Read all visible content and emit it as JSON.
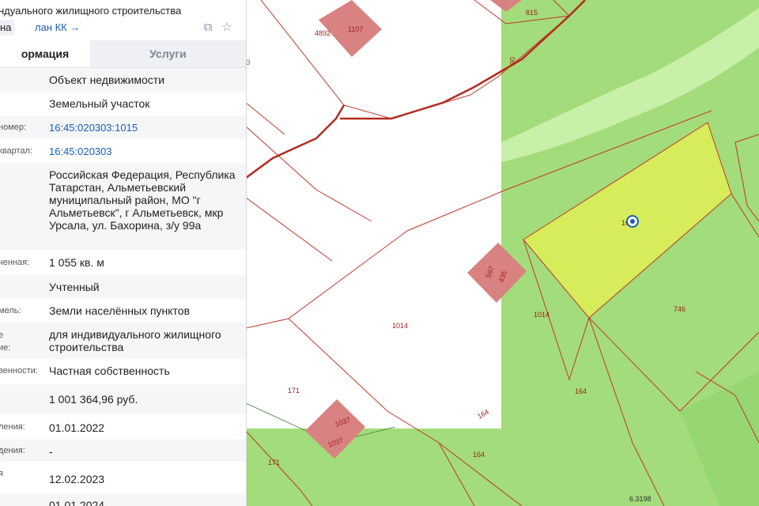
{
  "panel": {
    "header_title": "ндуального жилищного строительства",
    "chip_label": "на",
    "plan_link": "лан КК",
    "tabs": [
      {
        "label": "ормация"
      },
      {
        "label": "Услуги"
      }
    ],
    "rows": [
      {
        "label": "",
        "value": "Объект недвижимости"
      },
      {
        "label": "",
        "value": "Земельный участок"
      },
      {
        "label": "номер:",
        "value": "16:45:020303:1015"
      },
      {
        "label": "квартал:",
        "value": "16:45:020303"
      },
      {
        "label": "",
        "value": "Российская Федерация, Республика Татарстан, Альметьевский муниципальный район, МО \"г Альметьевск\", г Альметьевск, мкр Урсала, ул. Бахорина, з/у 99а"
      },
      {
        "label": "ченная:",
        "value": "1 055 кв. м"
      },
      {
        "label": "",
        "value": "Учтенный"
      },
      {
        "label": "мель:",
        "value": "Земли населённых пунктов"
      },
      {
        "label": "е\nие:",
        "value": "для индивидуального жилищного строительства"
      },
      {
        "label": "венности:",
        "value": "Частная собственность"
      },
      {
        "label": "",
        "value": "1 001 364,96 руб."
      },
      {
        "label": "ления:",
        "value": "01.01.2022"
      },
      {
        "label": "дения:",
        "value": "-"
      },
      {
        "label": "я",
        "value": "12.02.2023"
      },
      {
        "label": "",
        "value": "01.01.2024"
      }
    ]
  },
  "map": {
    "labels": {
      "l1107": "1107",
      "l4892": "4892",
      "l815": "815",
      "l06": "06",
      "l0": "0",
      "l1014a": "1014",
      "l1014b": "1014",
      "l587": "587",
      "l435": "435",
      "l746": "746",
      "l164a": "164",
      "l164b": "164",
      "l164c": "164",
      "l171a": "171",
      "l171b": "171",
      "l1037a": "1037",
      "l1037b": "1037",
      "l10": "10",
      "l6319": "6.3198"
    },
    "colors": {
      "green": "#a3dc7a",
      "light_green": "#c9f0a8",
      "selected": "#d6ec5a",
      "boundary": "#c0392b",
      "building": "#d98282"
    }
  }
}
